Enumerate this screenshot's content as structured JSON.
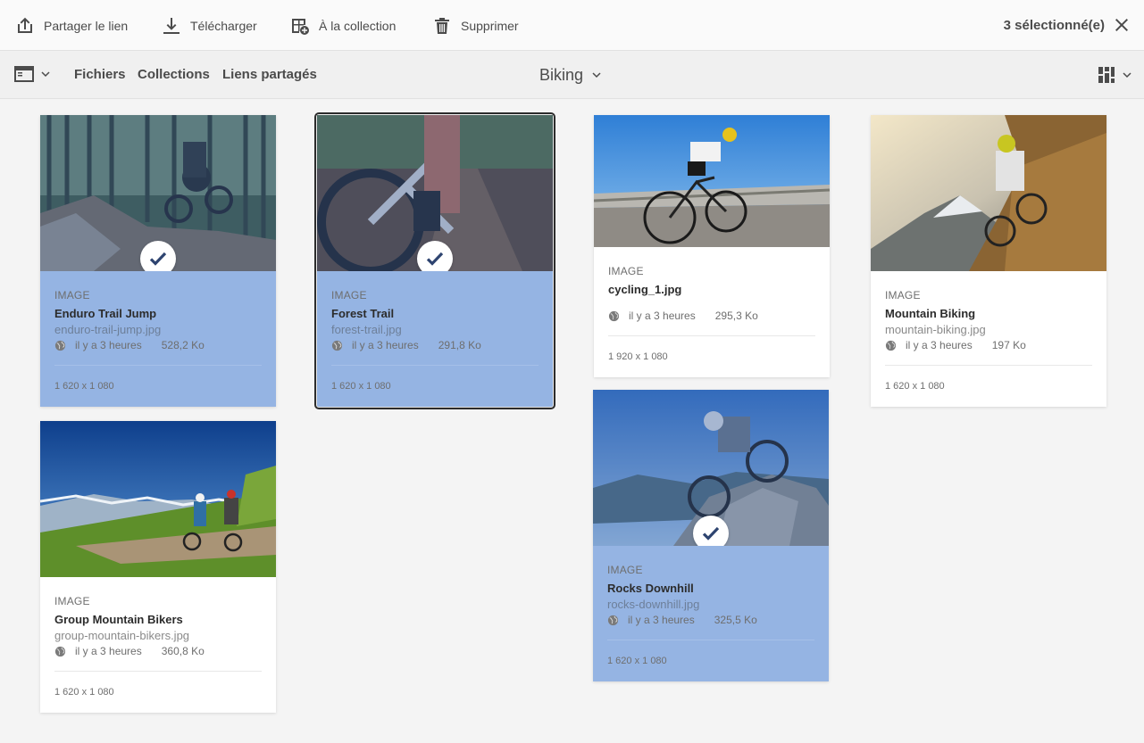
{
  "actionbar": {
    "share_label": "Partager le lien",
    "download_label": "Télécharger",
    "to_collection_label": "À la collection",
    "delete_label": "Supprimer",
    "selection_count": "3 sélectionné(e)"
  },
  "navbar": {
    "files_label": "Fichiers",
    "collections_label": "Collections",
    "shared_links_label": "Liens partagés",
    "folder_title": "Biking"
  },
  "cards": [
    {
      "type": "IMAGE",
      "title": "Enduro Trail Jump",
      "filename": "enduro-trail-jump.jpg",
      "modified": "il y a 3 heures",
      "size": "528,2 Ko",
      "resolution": "1 620 x 1 080",
      "selected": true
    },
    {
      "type": "IMAGE",
      "title": "Forest Trail",
      "filename": "forest-trail.jpg",
      "modified": "il y a 3 heures",
      "size": "291,8 Ko",
      "resolution": "1 620 x 1 080",
      "selected": true
    },
    {
      "type": "IMAGE",
      "title": "cycling_1.jpg",
      "filename": "",
      "modified": "il y a 3 heures",
      "size": "295,3 Ko",
      "resolution": "1 920 x 1 080",
      "selected": false
    },
    {
      "type": "IMAGE",
      "title": "Mountain Biking",
      "filename": "mountain-biking.jpg",
      "modified": "il y a 3 heures",
      "size": "197 Ko",
      "resolution": "1 620 x 1 080",
      "selected": false
    },
    {
      "type": "IMAGE",
      "title": "Group Mountain Bikers",
      "filename": "group-mountain-bikers.jpg",
      "modified": "il y a 3 heures",
      "size": "360,8 Ko",
      "resolution": "1 620 x 1 080",
      "selected": false
    },
    {
      "type": "IMAGE",
      "title": "Rocks Downhill",
      "filename": "rocks-downhill.jpg",
      "modified": "il y a 3 heures",
      "size": "325,5 Ko",
      "resolution": "1 620 x 1 080",
      "selected": true
    }
  ],
  "colors": {
    "selected_card": "#95b4e3",
    "accent": "#2c2c2c"
  }
}
